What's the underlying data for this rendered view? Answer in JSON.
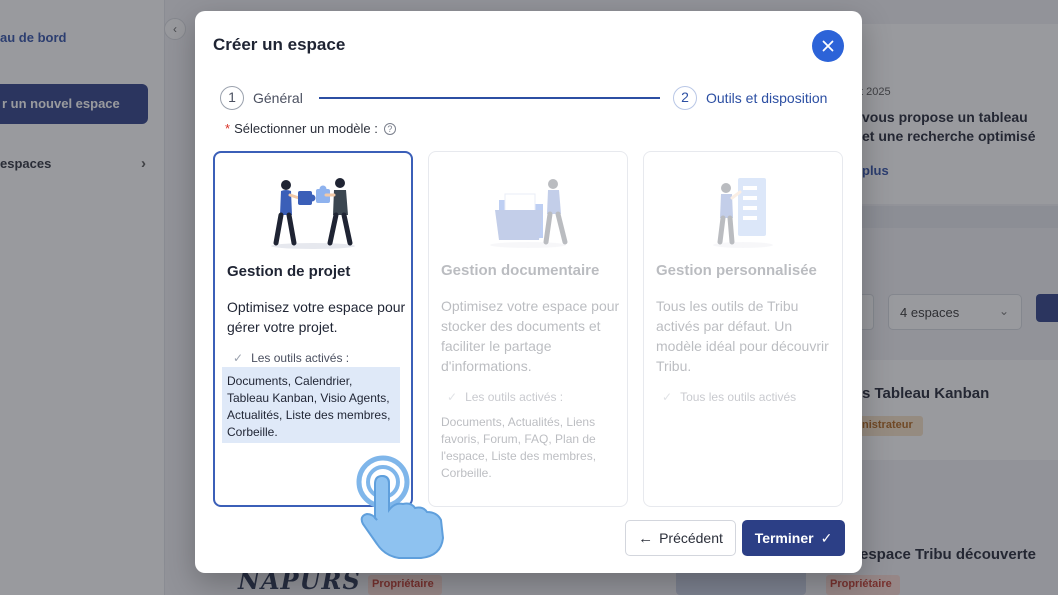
{
  "background": {
    "sidebar_link": "au de bord",
    "sidebar_button": "r un nouvel espace",
    "sidebar_item": "espaces",
    "date": "t 2025",
    "news_line1": "vous propose un tableau",
    "news_line2": "et une recherche optimisé",
    "more_link": "plus",
    "select_value": "4 espaces",
    "kanban_title": "s Tableau Kanban",
    "kanban_badge": "nistrateur",
    "discover_title": "espace Tribu découverte",
    "owner_badge": "Propriétaire",
    "owner_badge2": "Propriétaire",
    "logo_text": "NAPURS"
  },
  "modal": {
    "title": "Créer un espace",
    "steps": [
      {
        "number": "1",
        "label": "Général"
      },
      {
        "number": "2",
        "label": "Outils et disposition"
      }
    ],
    "template_label": "Sélectionner un modèle :",
    "required_mark": "*",
    "help_glyph": "?",
    "cards": [
      {
        "title": "Gestion de projet",
        "description": "Optimisez votre espace pour gérer votre projet.",
        "tools_label": "Les outils activés :",
        "tools": "Documents, Calendrier, Tableau Kanban, Visio Agents, Actualités, Liste des membres, Corbeille.",
        "selected": true
      },
      {
        "title": "Gestion documentaire",
        "description": "Optimisez votre espace pour stocker des documents et faciliter le partage d'informations.",
        "tools_label": "Les outils activés :",
        "tools": "Documents, Actualités, Liens favoris, Forum, FAQ, Plan de l'espace, Liste des membres, Corbeille.",
        "selected": false
      },
      {
        "title": "Gestion personnalisée",
        "description": "Tous les outils de Tribu activés par défaut. Un modèle idéal pour découvrir Tribu.",
        "tools_label": "Tous les outils activés",
        "selected": false
      }
    ],
    "prev_button": "Précédent",
    "prev_arrow": "←",
    "finish_button": "Terminer",
    "check_glyph": "✓"
  },
  "colors": {
    "accent": "#2c63d8",
    "primary_button": "#2c3f86",
    "selected_border": "#3b5fb8",
    "tools_highlight": "#dfe9f8"
  }
}
